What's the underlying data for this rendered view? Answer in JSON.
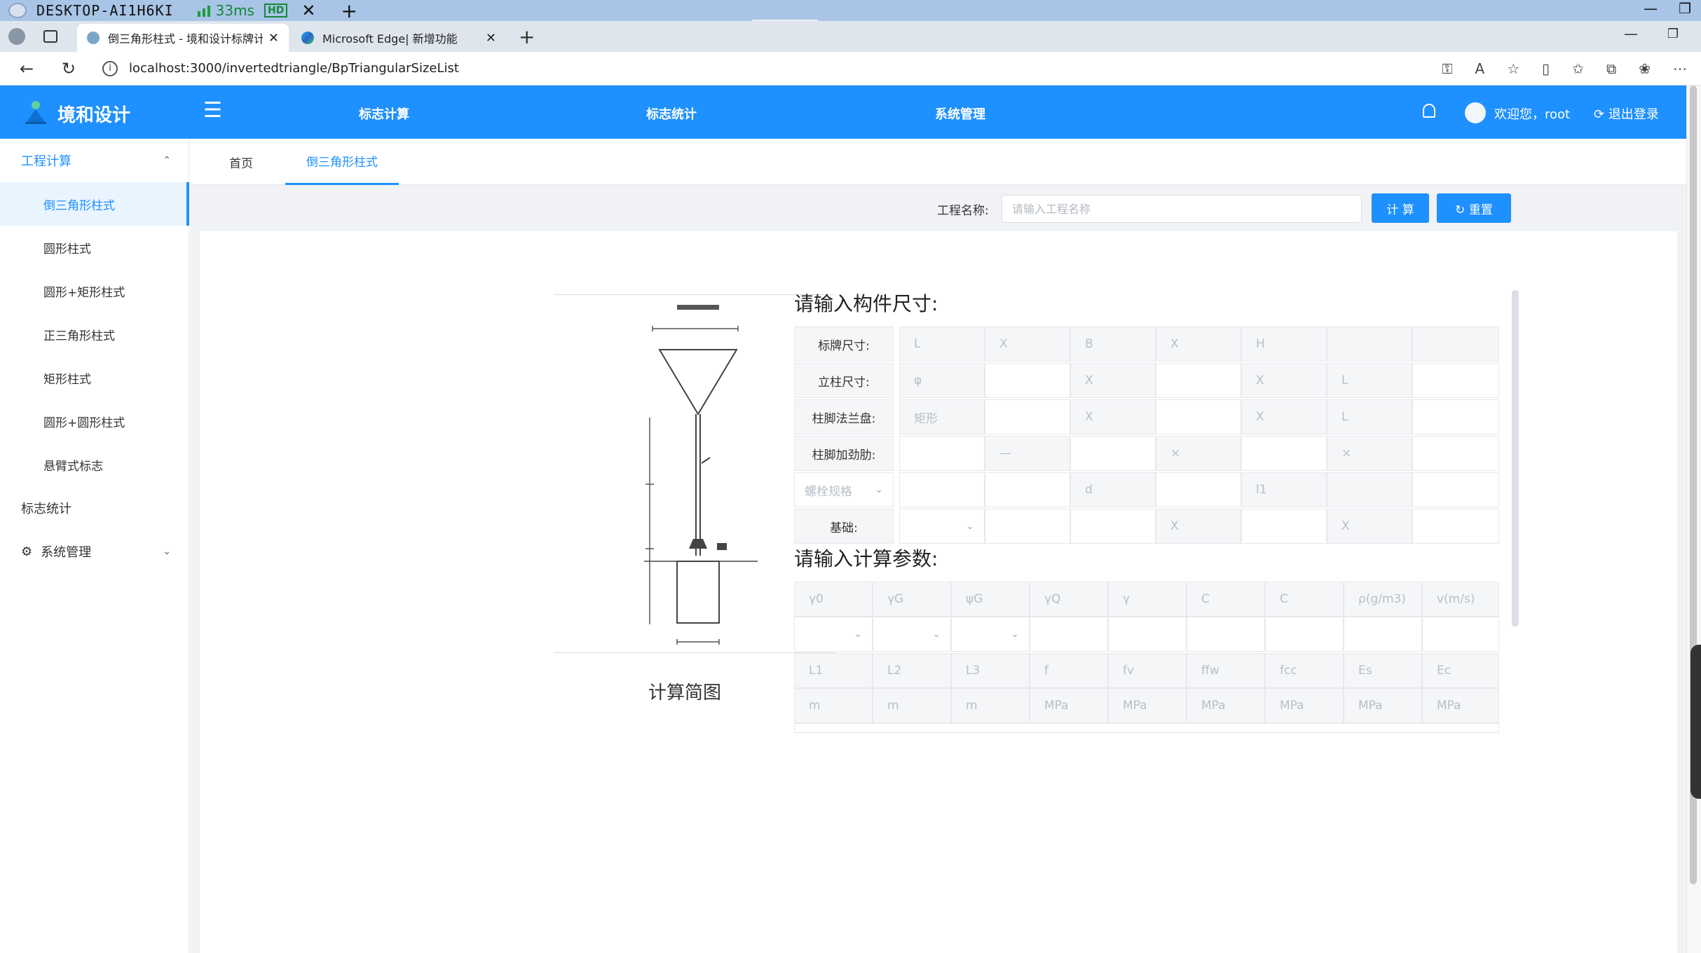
{
  "remote": {
    "title": "DESKTOP-AI1H6KI",
    "latency": "33ms",
    "hd": "HD"
  },
  "browser": {
    "tabs": [
      {
        "label": "倒三角形柱式 - 境和设计标牌计算"
      },
      {
        "label": "Microsoft Edge| 新增功能"
      }
    ],
    "url": "localhost:3000/invertedtriangle/BpTriangularSizeList"
  },
  "topnav": {
    "brand": "境和设计",
    "menu": [
      "标志计算",
      "标志统计",
      "系统管理"
    ],
    "welcome": "欢迎您，root",
    "logout": "退出登录"
  },
  "sidebar": {
    "group1": "工程计算",
    "items": [
      "倒三角形柱式",
      "圆形柱式",
      "圆形+矩形柱式",
      "正三角形柱式",
      "矩形柱式",
      "圆形+圆形柱式",
      "悬臂式标志"
    ],
    "group2": "标志统计",
    "group3": "系统管理"
  },
  "tags": [
    "首页",
    "倒三角形柱式"
  ],
  "search": {
    "label": "工程名称:",
    "placeholder": "请输入工程名称",
    "calc": "计 算",
    "reset": "重置"
  },
  "diagram": {
    "caption": "计算简图"
  },
  "size_form": {
    "title": "请输入构件尺寸:",
    "row_labels": [
      "标牌尺寸:",
      "立柱尺寸:",
      "柱脚法兰盘:",
      "柱脚加劲肋:",
      "螺栓规格",
      "基础:"
    ],
    "rows": [
      [
        "L",
        "X",
        "B",
        "X",
        "H",
        "",
        ""
      ],
      [
        "φ",
        "",
        "X",
        "",
        "X",
        "L",
        ""
      ],
      [
        "矩形",
        "",
        "X",
        "",
        "X",
        "L",
        ""
      ],
      [
        "",
        "—",
        "",
        "×",
        "",
        "×",
        ""
      ],
      [
        "",
        "",
        "d",
        "",
        "l1",
        "",
        ""
      ],
      [
        "",
        "",
        "",
        "X",
        "",
        "X",
        ""
      ]
    ]
  },
  "param_form": {
    "title": "请输入计算参数:",
    "row1": [
      "γ0",
      "γG",
      "ψG",
      "γQ",
      "γ",
      "C",
      "C",
      "ρ(g/m3)",
      "v(m/s)"
    ],
    "row3": [
      "L1",
      "L2",
      "L3",
      "f",
      "fv",
      "ffw",
      "fcc",
      "Es",
      "Ec"
    ],
    "row4": [
      "m",
      "m",
      "m",
      "MPa",
      "MPa",
      "MPa",
      "MPa",
      "MPa",
      "MPa"
    ]
  }
}
